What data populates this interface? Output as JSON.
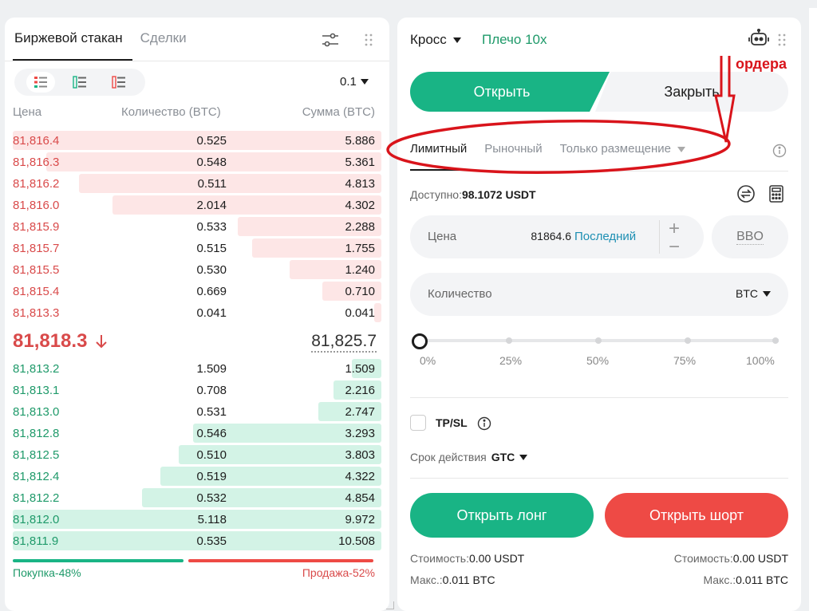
{
  "orderbook": {
    "tabs": [
      "Биржевой стакан",
      "Сделки"
    ],
    "precision": "0.1",
    "headers": {
      "price": "Цена",
      "qty": "Количество (BTC)",
      "sum": "Сумма (BTC)"
    },
    "asks": [
      {
        "price": "81,816.4",
        "qty": "0.525",
        "sum": "5.886",
        "depth": 1.0
      },
      {
        "price": "81,816.3",
        "qty": "0.548",
        "sum": "5.361",
        "depth": 0.91
      },
      {
        "price": "81,816.2",
        "qty": "0.511",
        "sum": "4.813",
        "depth": 0.82
      },
      {
        "price": "81,816.0",
        "qty": "2.014",
        "sum": "4.302",
        "depth": 0.73
      },
      {
        "price": "81,815.9",
        "qty": "0.533",
        "sum": "2.288",
        "depth": 0.39
      },
      {
        "price": "81,815.7",
        "qty": "0.515",
        "sum": "1.755",
        "depth": 0.35
      },
      {
        "price": "81,815.5",
        "qty": "0.530",
        "sum": "1.240",
        "depth": 0.25
      },
      {
        "price": "81,815.4",
        "qty": "0.669",
        "sum": "0.710",
        "depth": 0.16
      },
      {
        "price": "81,813.3",
        "qty": "0.041",
        "sum": "0.041",
        "depth": 0.02
      }
    ],
    "mid_price": "81,818.3",
    "mark_price": "81,825.7",
    "bids": [
      {
        "price": "81,813.2",
        "qty": "1.509",
        "sum": "1.509",
        "depth": 0.08
      },
      {
        "price": "81,813.1",
        "qty": "0.708",
        "sum": "2.216",
        "depth": 0.13
      },
      {
        "price": "81,813.0",
        "qty": "0.531",
        "sum": "2.747",
        "depth": 0.17
      },
      {
        "price": "81,812.8",
        "qty": "0.546",
        "sum": "3.293",
        "depth": 0.51
      },
      {
        "price": "81,812.5",
        "qty": "0.510",
        "sum": "3.803",
        "depth": 0.55
      },
      {
        "price": "81,812.4",
        "qty": "0.519",
        "sum": "4.322",
        "depth": 0.6
      },
      {
        "price": "81,812.2",
        "qty": "0.532",
        "sum": "4.854",
        "depth": 0.65
      },
      {
        "price": "81,812.0",
        "qty": "5.118",
        "sum": "9.972",
        "depth": 1.0
      },
      {
        "price": "81,811.9",
        "qty": "0.535",
        "sum": "10.508",
        "depth": 1.0
      }
    ],
    "buy_ratio_label": "Покупка-",
    "buy_ratio": "48%",
    "sell_ratio_label": "Продажа-",
    "sell_ratio": "52%",
    "buy_ratio_value": 0.48
  },
  "trade": {
    "margin_mode": "Кросс",
    "leverage": "Плечо 10x",
    "open_tab": "Открыть",
    "close_tab": "Закрыть",
    "order_types": [
      "Лимитный",
      "Рыночный",
      "Только размещение"
    ],
    "available_label": "Доступно:",
    "available_value": "98.1072 USDT",
    "price_label": "Цена",
    "price_value": "81864.6",
    "price_last": "Последний",
    "bbo": "BBO",
    "qty_label": "Количество",
    "qty_unit": "BTC",
    "slider_marks": [
      "0%",
      "25%",
      "50%",
      "75%",
      "100%"
    ],
    "slider_value": 0,
    "tpsl_label": "TP/SL",
    "tif_label": "Срок действия",
    "tif_value": "GTC",
    "btn_long": "Открыть лонг",
    "btn_short": "Открыть шорт",
    "cost_label": "Стоимость:",
    "cost_long": "0.00 USDT",
    "cost_short": "0.00 USDT",
    "max_label": "Макс.:",
    "max_long": "0.011 BTC",
    "max_short": "0.011 BTC"
  },
  "annotation": {
    "text": "ордера",
    "color": "#d9141b"
  },
  "colors": {
    "green": "#19b485",
    "red": "#ee4a45",
    "bid_text": "#1f9a6a",
    "ask_text": "#d94a4a"
  },
  "icons": [
    "settings-sliders-icon",
    "drag-dots-icon",
    "view-both-icon",
    "view-bids-icon",
    "view-asks-icon",
    "arrow-down-icon",
    "robot-icon",
    "info-icon",
    "swap-icon",
    "calculator-icon"
  ]
}
